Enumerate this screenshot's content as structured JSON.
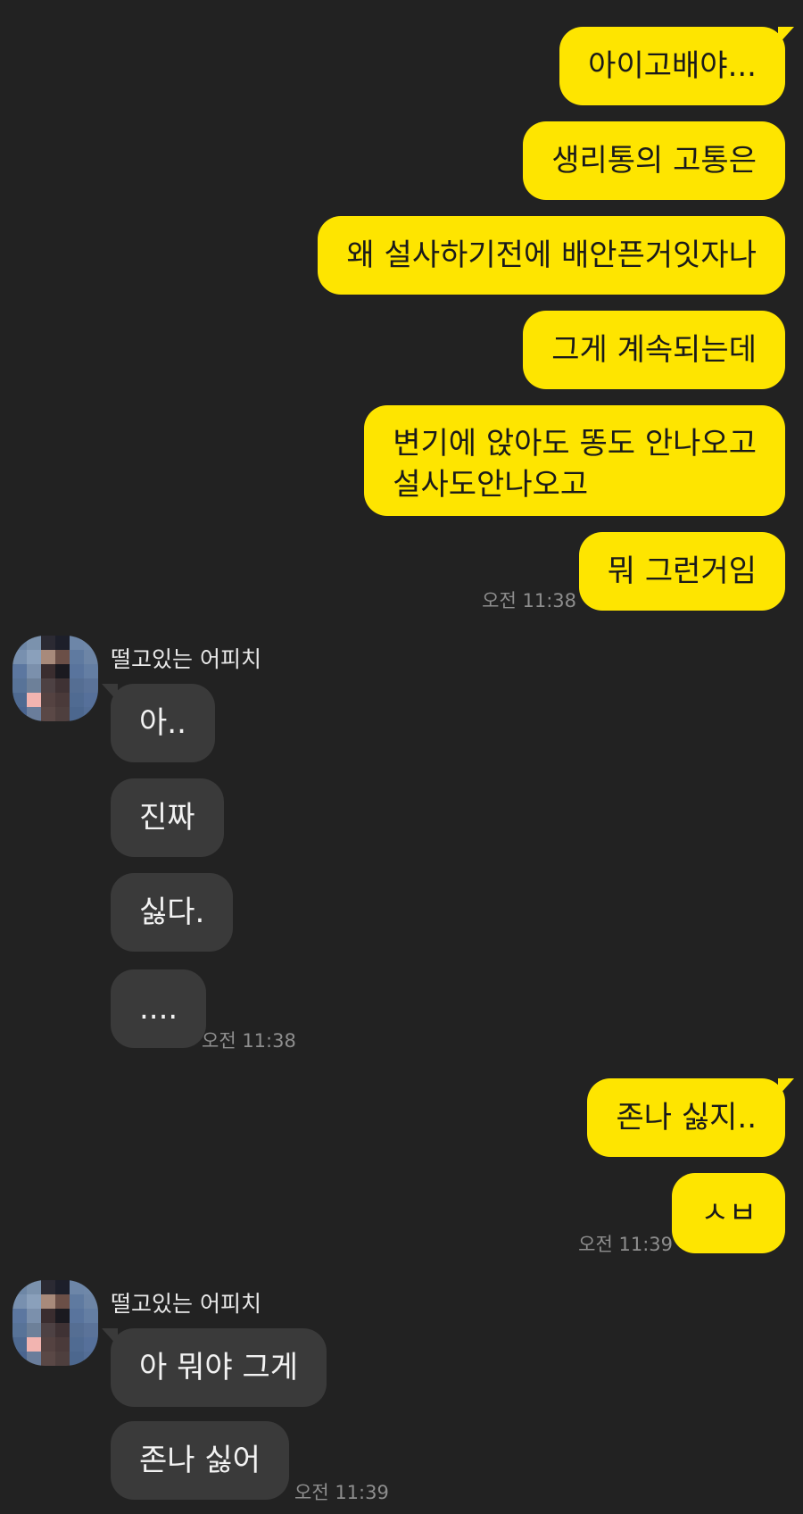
{
  "messages_me_1": [
    {
      "text": "아이고배야..."
    },
    {
      "text": "생리통의 고통은"
    },
    {
      "text": "왜 설사하기전에 배안픈거잇자나"
    },
    {
      "text": "그게 계속되는데"
    },
    {
      "text": "변기에 앉아도 똥도 안나오고\n설사도안나오고"
    },
    {
      "text": "뭐 그런거임"
    }
  ],
  "time_me_1": "오전 11:38",
  "group_them_1": {
    "sender": "떨고있는 어피치",
    "messages": [
      {
        "text": "아.."
      },
      {
        "text": "진짜"
      },
      {
        "text": "싫다."
      },
      {
        "text": "...."
      }
    ],
    "time": "오전 11:38"
  },
  "messages_me_2": [
    {
      "text": "존나 싫지.."
    },
    {
      "text": "ㅅㅂ"
    }
  ],
  "time_me_2": "오전 11:39",
  "group_them_2": {
    "sender": "떨고있는 어피치",
    "messages": [
      {
        "text": "아 뭐야 그게"
      },
      {
        "text": "존나 싫어"
      }
    ],
    "time": "오전 11:39"
  },
  "colors": {
    "background": "#222222",
    "my_bubble": "#FEE500",
    "their_bubble": "#3a3a3a",
    "timestamp": "#8e8e8e"
  },
  "avatar_icon": "pixelated-profile-icon"
}
